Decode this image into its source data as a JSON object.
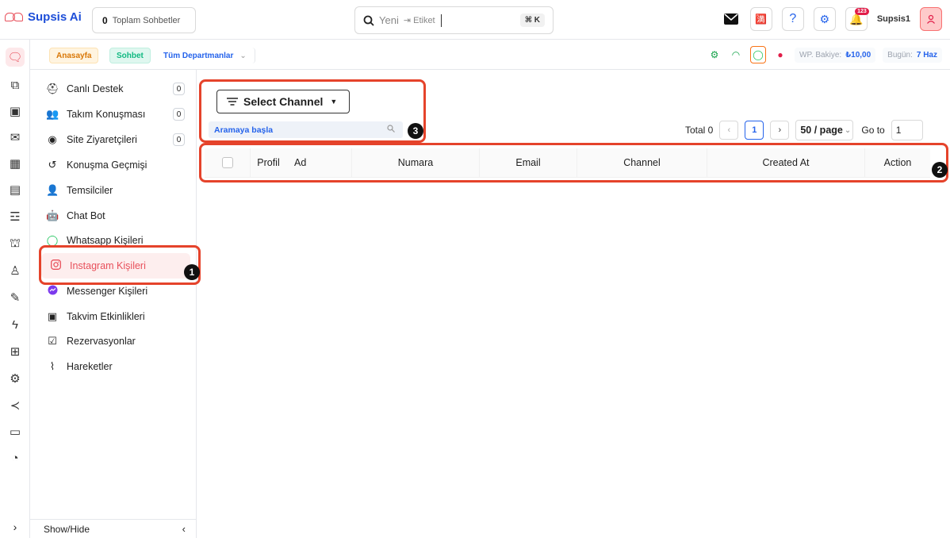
{
  "app": {
    "logo_text": "Supsis Ai"
  },
  "topbar": {
    "total_chats_count": "0",
    "total_chats_label": "Toplam Sohbetler",
    "search_placeholder": "Yeni",
    "search_tag_hint": "⇥ Etiket",
    "search_shortcut": "⌘ K",
    "notification_count": "123",
    "username": "Supsis1"
  },
  "subbar": {
    "crumb_home": "Anasayfa",
    "crumb_chat": "Sohbet",
    "department": "Tüm Departmanlar",
    "wp_balance_label": "WP. Bakiye:",
    "wp_balance_value": "₺10,00",
    "today_label": "Bugün:",
    "today_value": "7 Haz"
  },
  "sidebar": {
    "items": [
      {
        "label": "Canlı Destek",
        "icon": "headset-icon",
        "count": "0"
      },
      {
        "label": "Takım Konuşması",
        "icon": "team-icon",
        "count": "0"
      },
      {
        "label": "Site Ziyaretçileri",
        "icon": "compass-icon",
        "count": "0"
      },
      {
        "label": "Konuşma Geçmişi",
        "icon": "history-icon"
      },
      {
        "label": "Temsilciler",
        "icon": "agents-icon"
      },
      {
        "label": "Chat Bot",
        "icon": "bot-icon"
      },
      {
        "label": "Whatsapp Kişileri",
        "icon": "whatsapp-icon"
      },
      {
        "label": "Instagram Kişileri",
        "icon": "instagram-icon",
        "active": true
      },
      {
        "label": "Messenger Kişileri",
        "icon": "messenger-icon"
      },
      {
        "label": "Takvim Etkinlikleri",
        "icon": "calendar-icon"
      },
      {
        "label": "Rezervasyonlar",
        "icon": "calendar-check-icon"
      },
      {
        "label": "Hareketler",
        "icon": "rss-icon"
      }
    ],
    "show_hide_label": "Show/Hide"
  },
  "main": {
    "select_channel_label": "Select Channel",
    "search_placeholder": "Aramaya başla",
    "pagination": {
      "total_text": "Total 0",
      "current_page": "1",
      "page_size": "50 / page",
      "goto_label": "Go to",
      "goto_value": "1"
    },
    "table": {
      "columns": [
        "Profil",
        "Ad",
        "Numara",
        "Email",
        "Channel",
        "Created At",
        "Action"
      ]
    }
  },
  "annotations": {
    "badge_1": "1",
    "badge_2": "2",
    "badge_3": "3"
  },
  "colors": {
    "accent_red": "#e5432b",
    "brand_blue": "#1d4ed8",
    "active_pink": "#e8505b"
  }
}
